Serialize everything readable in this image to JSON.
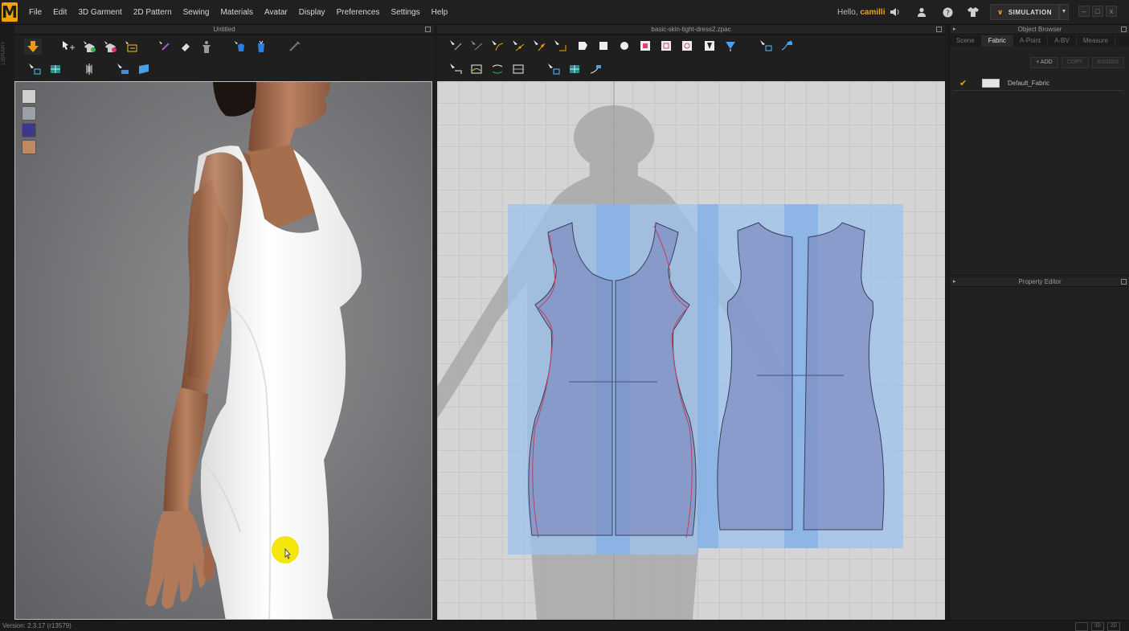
{
  "app": {
    "logo": "M",
    "menus": [
      "File",
      "Edit",
      "3D Garment",
      "2D Pattern",
      "Sewing",
      "Materials",
      "Avatar",
      "Display",
      "Preferences",
      "Settings",
      "Help"
    ],
    "greeting": "Hello,",
    "username": "camilli",
    "simulation_label": "SIMULATION",
    "window_controls": [
      "–",
      "□",
      "x"
    ]
  },
  "panels": {
    "view3d_title": "Untitled",
    "view2d_title": "basic-skin-tight-dress2.zpac",
    "object_browser_title": "Object Browser",
    "property_editor_title": "Property Editor",
    "side_strip_label": "LIBRARY"
  },
  "object_browser": {
    "tabs": [
      "Scene",
      "Fabric",
      "A-Point",
      "A-BV",
      "Measure"
    ],
    "active_tab": "Fabric",
    "actions": {
      "add": "+ ADD",
      "copy": "COPY",
      "assign": "ASSIGN"
    },
    "fabrics": [
      {
        "name": "Default_Fabric",
        "selected": true,
        "color": "#e4e4e4"
      }
    ]
  },
  "status": {
    "version": "Version: 2.3.17     (r13579)",
    "view_modes": [
      "",
      "3D",
      "2D"
    ]
  },
  "colors": {
    "accent": "#f0a20a",
    "pattern_fill": "#7f8fc4",
    "pattern_select": "#9ec3ee",
    "garment": "#ffffff",
    "skin": "#b98160"
  },
  "icons": {
    "toolbar3d_row1": [
      "simulate-icon",
      "select-move-icon",
      "add-garment-icon",
      "remove-garment-icon",
      "import-icon",
      "pin-icon",
      "eraser-icon",
      "avatar-icon",
      "fold-icon",
      "tack-icon",
      "measure-icon"
    ],
    "toolbar3d_row2": [
      "select-mesh-icon",
      "texture-icon",
      "symmetry-icon",
      "transform-pattern-icon",
      "flatten-icon"
    ],
    "toolbar2d_row1": [
      "transform-pattern-icon",
      "edit-point-icon",
      "edit-curve-icon",
      "curve-point-icon",
      "add-point-icon",
      "cut-icon",
      "polygon-icon",
      "rectangle-icon",
      "circle-icon",
      "internal-polygon-icon",
      "internal-rect-icon",
      "internal-circle-icon",
      "dart-icon",
      "fold-arrow-icon",
      "trace-icon",
      "unfold-icon"
    ],
    "toolbar2d_row2": [
      "segment-sewing-icon",
      "free-sewing-icon",
      "edit-sewing-icon",
      "multi-sewing-icon",
      "texture-icon",
      "grid-icon",
      "edit-texture-icon"
    ],
    "viewport_tools": [
      "garment-display-icon",
      "avatar-display-icon",
      "fabric-display-icon",
      "skin-display-icon"
    ]
  }
}
